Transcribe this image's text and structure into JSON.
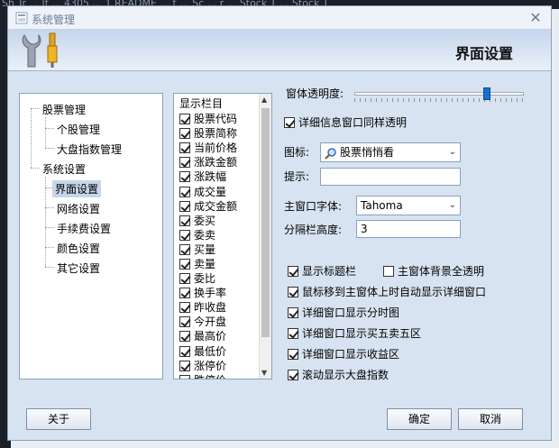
{
  "window": {
    "title": "系统管理",
    "banner_title": "界面设置",
    "close_glyph": "✕"
  },
  "tree": {
    "items": [
      {
        "label": "股票管理",
        "level": 0
      },
      {
        "label": "个股管理",
        "level": 1
      },
      {
        "label": "大盘指数管理",
        "level": 1
      },
      {
        "label": "系统设置",
        "level": 0
      },
      {
        "label": "界面设置",
        "level": 1,
        "selected": true
      },
      {
        "label": "网络设置",
        "level": 1
      },
      {
        "label": "手续费设置",
        "level": 1
      },
      {
        "label": "颜色设置",
        "level": 1
      },
      {
        "label": "其它设置",
        "level": 1
      }
    ]
  },
  "columns": {
    "header": "显示栏目",
    "items": [
      "股票代码",
      "股票简称",
      "当前价格",
      "涨跌金额",
      "涨跌幅",
      "成交量",
      "成交金额",
      "委买",
      "委卖",
      "买量",
      "卖量",
      "委比",
      "换手率",
      "昨收盘",
      "今开盘",
      "最高价",
      "最低价",
      "涨停价",
      "跌停价"
    ]
  },
  "settings": {
    "transparency_label": "窗体透明度:",
    "transparency_level": 0.78,
    "detail_transparent_label": "详细信息窗口同样透明",
    "detail_transparent_checked": true,
    "icon_label": "图标:",
    "icon_value": "股票悄悄看",
    "hint_label": "提示:",
    "hint_value": "",
    "font_label": "主窗口字体:",
    "font_value": "Tahoma",
    "splitter_label": "分隔栏高度:",
    "splitter_value": "3"
  },
  "options": [
    {
      "label": "显示标题栏",
      "checked": true
    },
    {
      "label": "主窗体背景全透明",
      "checked": false
    },
    {
      "label": "鼠标移到主窗体上时自动显示详细窗口",
      "checked": true
    },
    {
      "label": "详细窗口显示分时图",
      "checked": true
    },
    {
      "label": "详细窗口显示买五卖五区",
      "checked": true
    },
    {
      "label": "详细窗口显示收益区",
      "checked": true
    },
    {
      "label": "滚动显示大盘指数",
      "checked": true
    }
  ],
  "buttons": {
    "about": "关于",
    "ok": "确定",
    "cancel": "取消"
  },
  "background": {
    "strip_text": "Sh  Tr  ...  lf  ... 4305 ... 1  README  ...  t ...  Sc  ...  r  ...  Stock T  ...  Stock T"
  },
  "colors": {
    "accent": "#1c6fd1",
    "selection": "#c7d7ea",
    "window_bg": "#d8e3f1"
  }
}
